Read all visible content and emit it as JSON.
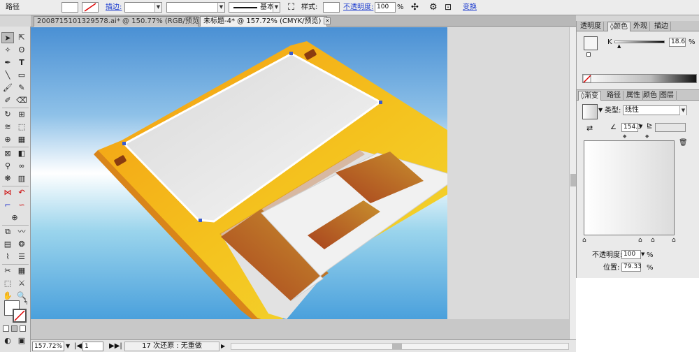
{
  "control_bar": {
    "object_type": "路径",
    "stroke_label": "描边:",
    "brush_label": "基本",
    "style_label": "样式:",
    "opacity_label": "不透明度:",
    "opacity_value": "100",
    "percent": "%",
    "transform_label": "变换"
  },
  "document_tabs": [
    {
      "label": "200871510132957​8.ai* @ 150.77% (RGB/预览)",
      "active": false
    },
    {
      "label": "未标题-4* @ 157.72% (CMYK/预览)",
      "active": true
    }
  ],
  "status_bar": {
    "zoom": "157.72%",
    "page": "1",
    "history": "17 次还原 : 无重做"
  },
  "color_panel": {
    "tabs": [
      "透明度",
      "颜色",
      "外观",
      "描边"
    ],
    "active_tab": "颜色",
    "channel_label": "K",
    "channel_value": "18.6",
    "percent": "%"
  },
  "gradient_panel": {
    "tabs": [
      "渐变",
      "路径",
      "属性",
      "颜色",
      "图层"
    ],
    "active_tab": "渐变",
    "type_label": "类型:",
    "type_value": "线性",
    "angle_value": "154.3",
    "opacity_label": "不透明度:",
    "opacity_value": "100",
    "location_label": "位置:",
    "location_value": "79.33",
    "percent": "%"
  },
  "colors": {
    "disk_yellow": "#f2b51c",
    "label_white": "#ececec",
    "shutter_silver": "#e6e6e6",
    "window_brown": "#b2552a",
    "link_blue": "#1d3dcf"
  }
}
